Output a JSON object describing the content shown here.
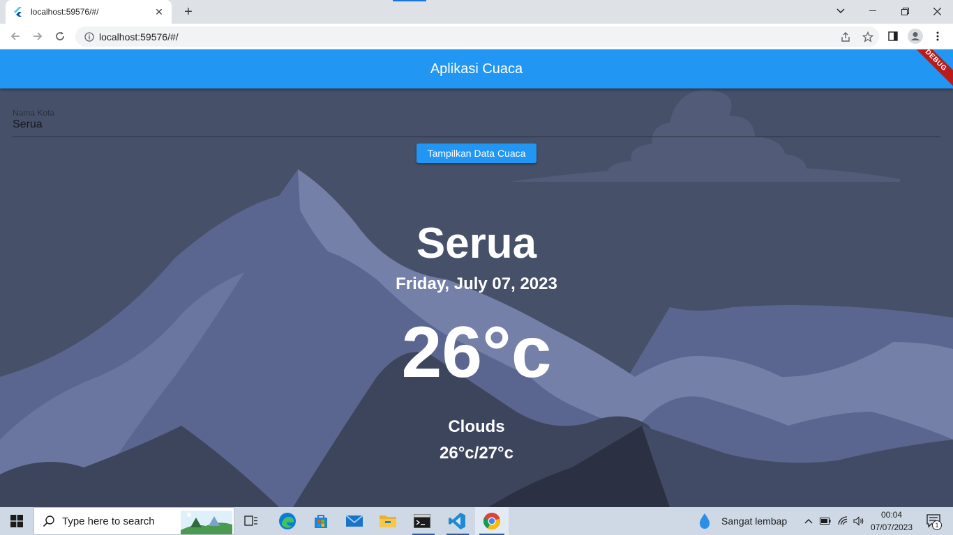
{
  "browser": {
    "tab_title": "localhost:59576/#/",
    "url": "localhost:59576/#/"
  },
  "app": {
    "title": "Aplikasi Cuaca",
    "debug_banner": "DEBUG",
    "city_field": {
      "label": "Nama Kota",
      "value": "Serua"
    },
    "show_button": "Tampilkan Data Cuaca",
    "weather": {
      "city": "Serua",
      "date": "Friday, July 07, 2023",
      "temperature": "26°c",
      "condition": "Clouds",
      "range": "26°c/27°c"
    }
  },
  "taskbar": {
    "search_placeholder": "Type here to search",
    "weather_widget": "Sangat lembap",
    "time": "00:04",
    "date": "07/07/2023",
    "notification_count": "1"
  },
  "colors": {
    "appbar": "#2196f3",
    "button": "#2196f3",
    "background": "#465069"
  }
}
